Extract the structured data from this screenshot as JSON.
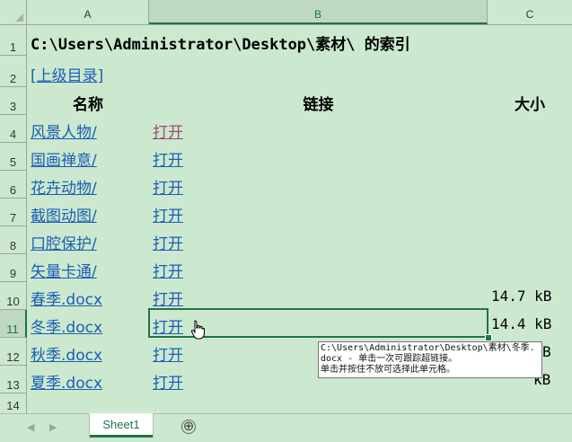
{
  "columns": [
    "A",
    "B",
    "C"
  ],
  "rows": [
    "1",
    "2",
    "3",
    "4",
    "5",
    "6",
    "7",
    "8",
    "9",
    "10",
    "11",
    "12",
    "13",
    "14"
  ],
  "title": "C:\\Users\\Administrator\\Desktop\\素材\\ 的索引",
  "parent_link": "[上级目录]",
  "headers": {
    "name": "名称",
    "link": "链接",
    "size": "大小"
  },
  "entries": [
    {
      "name": "风景人物/",
      "link": "打开",
      "size": ""
    },
    {
      "name": "国画禅意/",
      "link": "打开",
      "size": ""
    },
    {
      "name": "花卉动物/",
      "link": "打开",
      "size": ""
    },
    {
      "name": "截图动图/",
      "link": "打开",
      "size": ""
    },
    {
      "name": "口腔保护/",
      "link": "打开",
      "size": ""
    },
    {
      "name": "矢量卡通/",
      "link": "打开",
      "size": ""
    },
    {
      "name": "春季.docx",
      "link": "打开",
      "size": "14.7 kB"
    },
    {
      "name": "冬季.docx",
      "link": "打开",
      "size": "14.4 kB"
    },
    {
      "name": "秋季.docx",
      "link": "打开",
      "size": "B"
    },
    {
      "name": "夏季.docx",
      "link": "打开",
      "size": "kB"
    }
  ],
  "tooltip": {
    "line1": "C:\\Users\\Administrator\\Desktop\\素材\\冬季.",
    "line2": "docx - 单击一次可跟踪超链接。",
    "line3": "单击并按住不放可选择此单元格。"
  },
  "sheet_tab": "Sheet1",
  "add_sheet": "⊕",
  "colors": {
    "link": "#1a5fb4",
    "visited": "#954f72",
    "selection": "#217346",
    "background": "#cce8cf"
  }
}
